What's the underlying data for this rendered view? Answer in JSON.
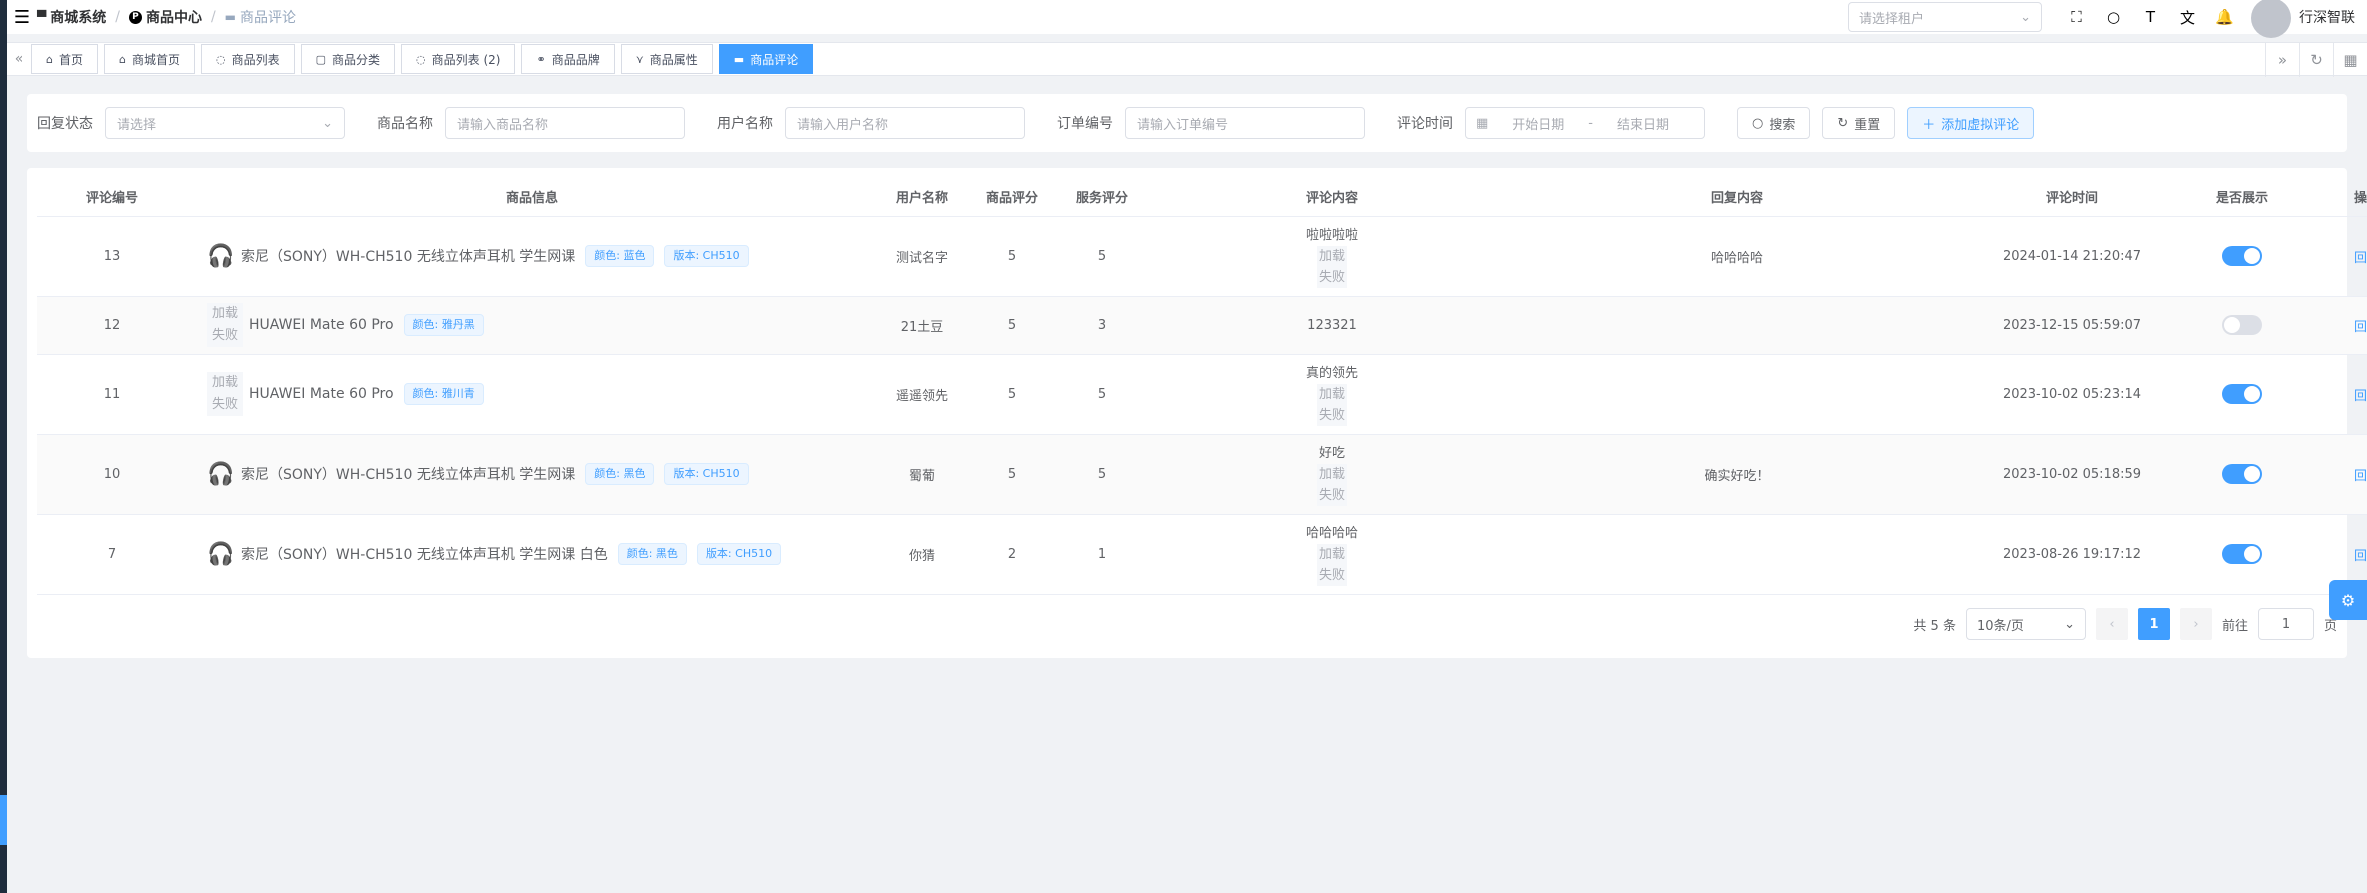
{
  "navbar": {
    "breadcrumb": [
      "商城系统",
      "商品中心",
      "商品评论"
    ],
    "tenant_placeholder": "请选择租户",
    "username": "行深智联"
  },
  "tags": [
    "首页",
    "商城首页",
    "商品列表",
    "商品分类",
    "商品列表 (2)",
    "商品品牌",
    "商品属性",
    "商品评论"
  ],
  "search": {
    "reply_status_label": "回复状态",
    "reply_status_placeholder": "请选择",
    "product_name_label": "商品名称",
    "product_name_placeholder": "请输入商品名称",
    "user_name_label": "用户名称",
    "user_name_placeholder": "请输入用户名称",
    "order_no_label": "订单编号",
    "order_no_placeholder": "请输入订单编号",
    "time_label": "评论时间",
    "start_placeholder": "开始日期",
    "range_sep": "-",
    "end_placeholder": "结束日期",
    "search_btn": "搜索",
    "reset_btn": "重置",
    "add_btn": "添加虚拟评论"
  },
  "table": {
    "headers": [
      "评论编号",
      "商品信息",
      "用户名称",
      "商品评分",
      "服务评分",
      "评论内容",
      "回复内容",
      "评论时间",
      "是否展示",
      "操作"
    ],
    "img_fail": [
      "加载",
      "失败"
    ],
    "rows": [
      {
        "id": "13",
        "product": "索尼（SONY）WH-CH510 无线立体声耳机 学生网课",
        "tags": [
          "颜色: 蓝色",
          "版本: CH510"
        ],
        "user": "测试名字",
        "score": "5",
        "service": "5",
        "content": "啦啦啦啦",
        "reply": "哈哈哈哈",
        "time": "2024-01-14 21:20:47",
        "action": "回复"
      },
      {
        "id": "12",
        "product": "HUAWEI Mate 60 Pro",
        "tags": [
          "颜色: 雅丹黑"
        ],
        "user": "21土豆",
        "score": "5",
        "service": "3",
        "content": "123321",
        "reply": "",
        "time": "2023-12-15 05:59:07",
        "action": "回复"
      },
      {
        "id": "11",
        "product": "HUAWEI Mate 60 Pro",
        "tags": [
          "颜色: 雅川青"
        ],
        "user": "遥遥领先",
        "score": "5",
        "service": "5",
        "content": "真的领先",
        "reply": "",
        "time": "2023-10-02 05:23:14",
        "action": "回复"
      },
      {
        "id": "10",
        "product": "索尼（SONY）WH-CH510 无线立体声耳机 学生网课",
        "tags": [
          "颜色: 黑色",
          "版本: CH510"
        ],
        "user": "蜀葡",
        "score": "5",
        "service": "5",
        "content": "好吃",
        "reply": "确实好吃！",
        "time": "2023-10-02 05:18:59",
        "action": "回复"
      },
      {
        "id": "7",
        "product": "索尼（SONY）WH-CH510 无线立体声耳机 学生网课 白色",
        "tags": [
          "颜色: 黑色",
          "版本: CH510"
        ],
        "user": "你猜",
        "score": "2",
        "service": "1",
        "content": "哈哈哈哈",
        "reply": "",
        "time": "2023-08-26 19:17:12",
        "action": "回复"
      }
    ]
  },
  "pagination": {
    "total": "共 5 条",
    "page_size": "10条/页",
    "current": "1",
    "goto": "前往",
    "goto_value": "1",
    "page_unit": "页"
  }
}
